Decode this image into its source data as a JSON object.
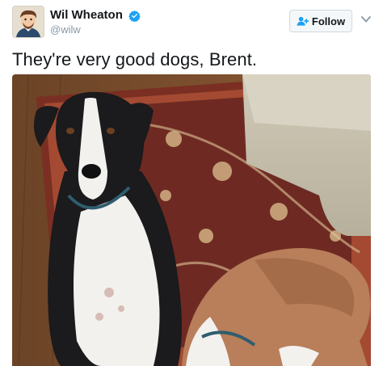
{
  "tweet": {
    "author": {
      "display_name": "Wil Wheaton",
      "handle": "@wilw",
      "verified": true,
      "avatar_icon": "avatar-cartoon-portrait"
    },
    "follow_label": "Follow",
    "text": "They're very good dogs, Brent.",
    "media": {
      "description_icon": "photo-two-dogs"
    }
  },
  "colors": {
    "verified_blue": "#1da1f2",
    "handle_gray": "#8899a6",
    "follow_bg": "#f5f8fa",
    "text": "#14171a"
  }
}
